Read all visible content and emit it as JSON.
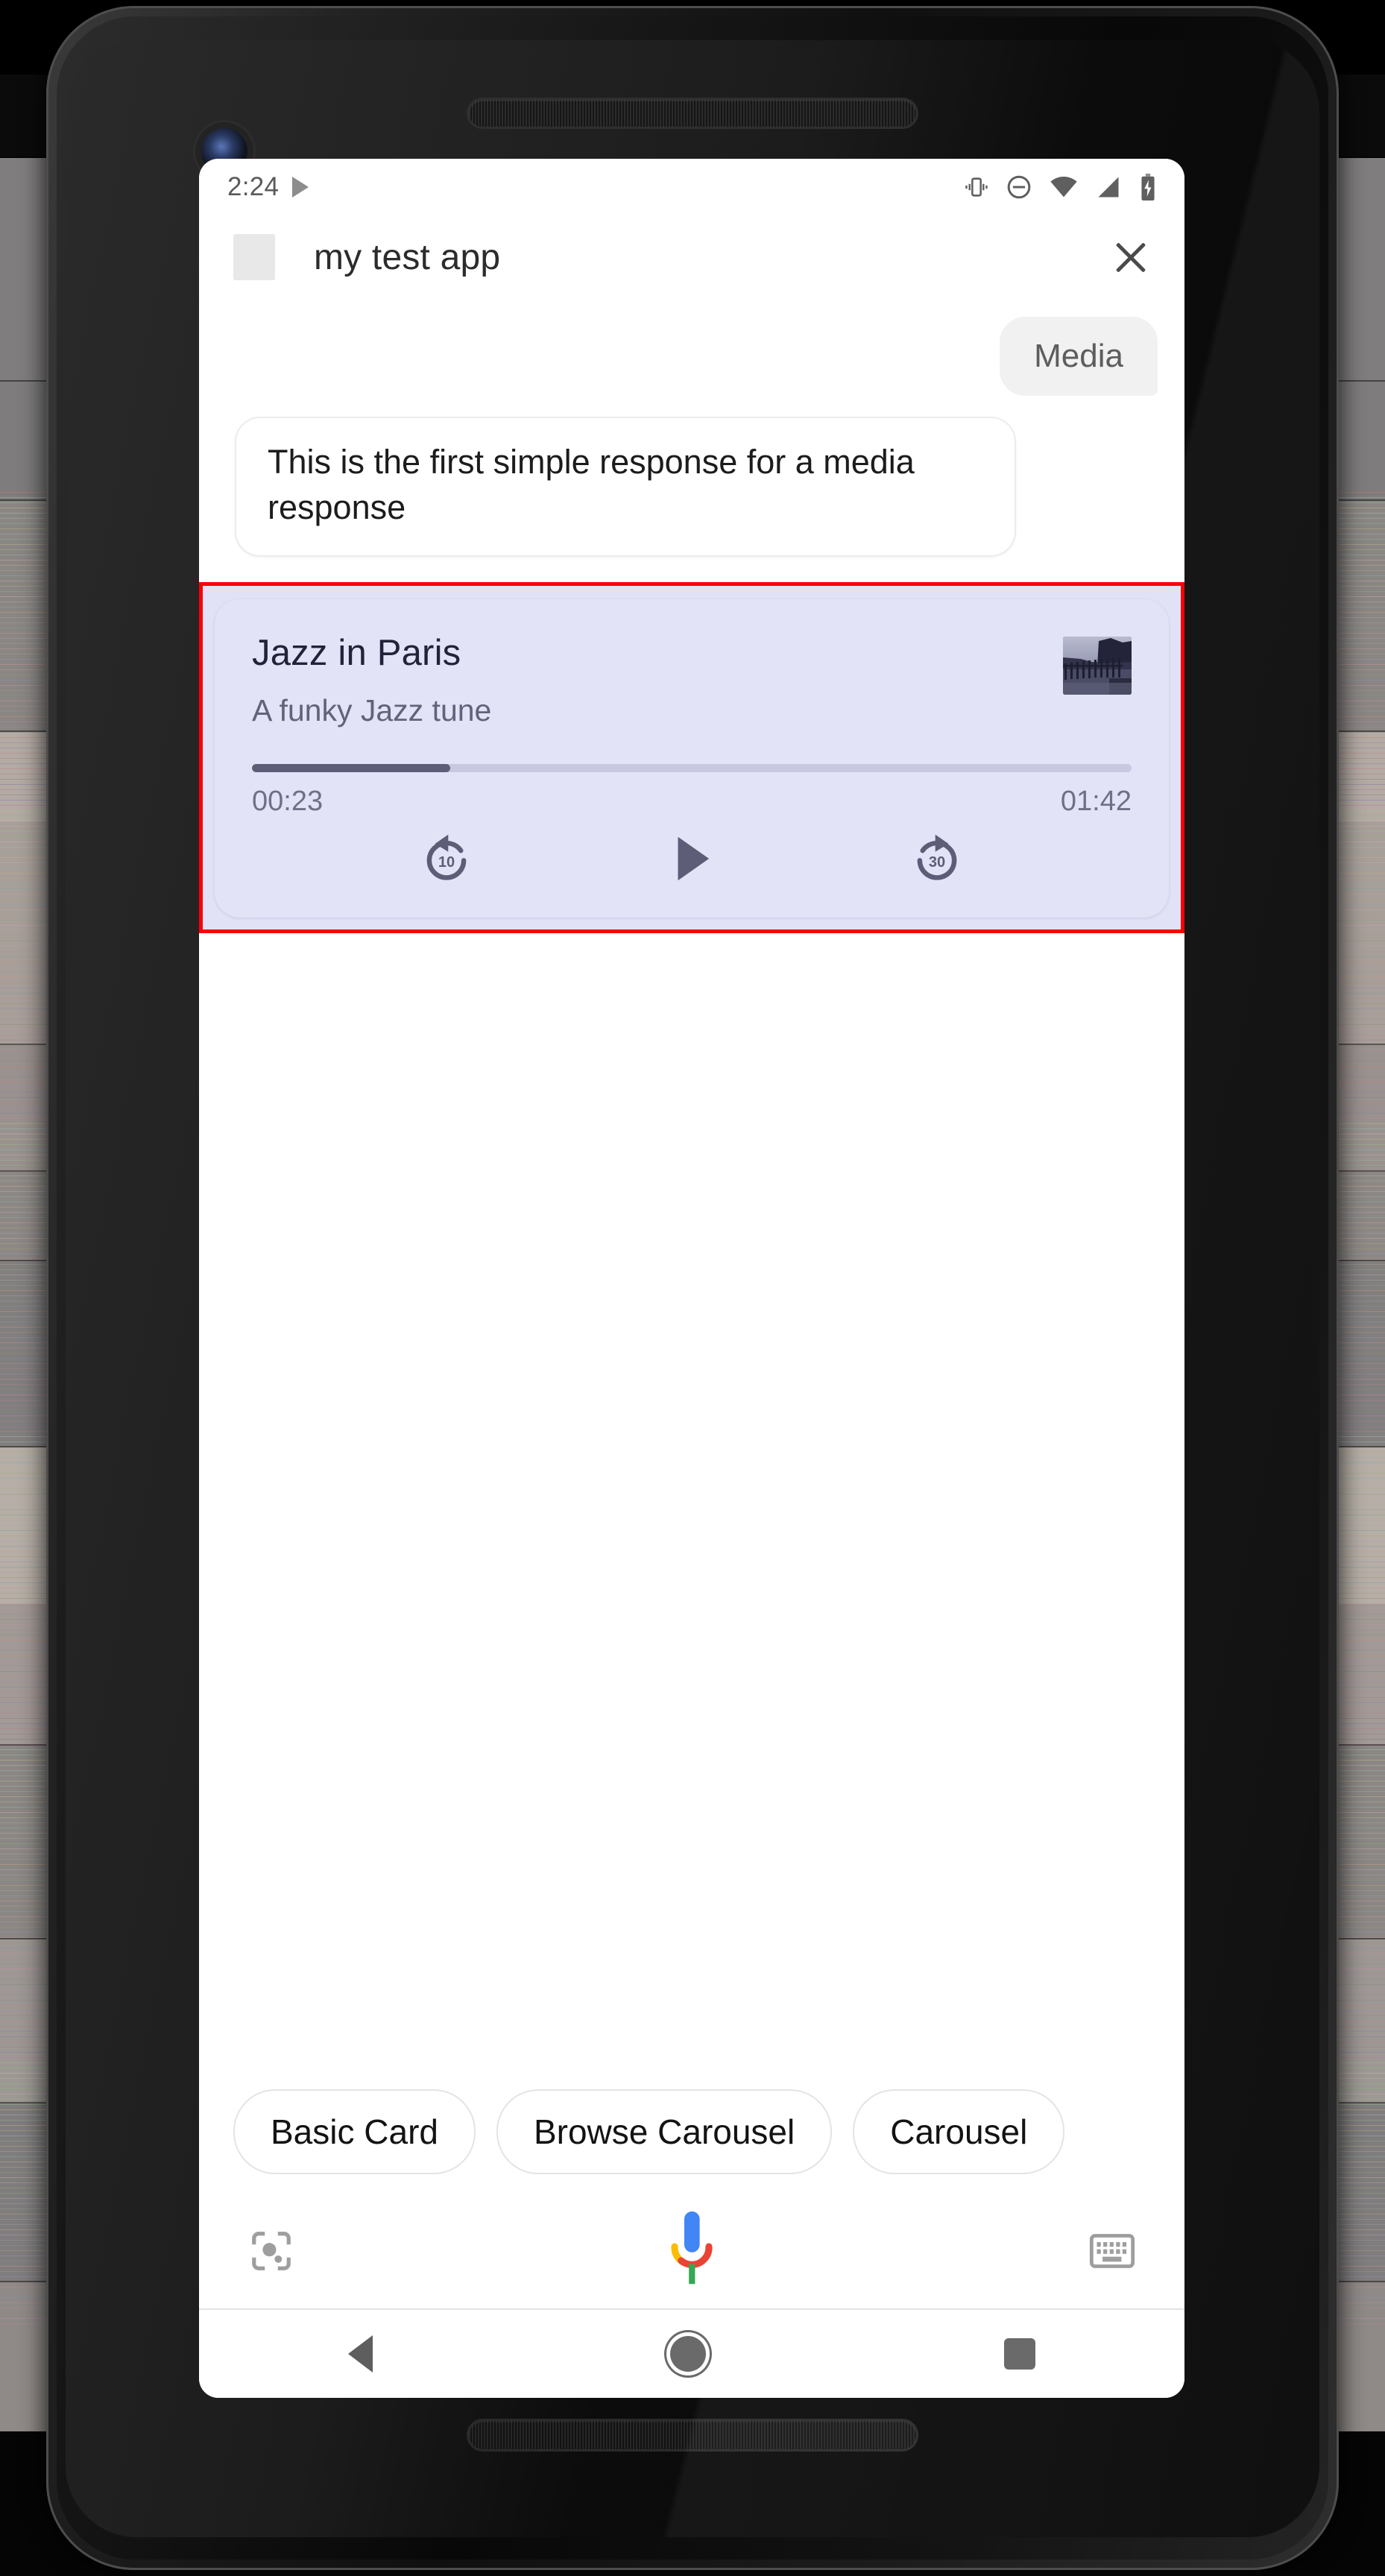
{
  "status_bar": {
    "time": "2:24",
    "icons": [
      "play-triangle-icon",
      "vibrate-icon",
      "do-not-disturb-icon",
      "wifi-icon",
      "cellular-signal-icon",
      "battery-charging-icon"
    ]
  },
  "app_header": {
    "title": "my test app",
    "close_label": "close-icon",
    "app_icon_name": "app-placeholder-icon"
  },
  "conversation": {
    "user_message": "Media",
    "bot_message": "This is the first simple response for a media response"
  },
  "media_card": {
    "title": "Jazz in Paris",
    "subtitle": "A funky Jazz tune",
    "current_time": "00:23",
    "total_time": "01:42",
    "progress_percent": 22.5,
    "highlight_color": "#fb0006",
    "card_background": "#e3e3f8",
    "accent_color": "#5d5d77",
    "track_color": "#c8c8e0",
    "controls": [
      {
        "name": "replay-10-icon",
        "label": "10"
      },
      {
        "name": "play-icon",
        "label": "Play"
      },
      {
        "name": "forward-30-icon",
        "label": "30"
      }
    ],
    "thumbnail_name": "album-art-thumbnail"
  },
  "suggestion_chips": [
    {
      "label": "Basic Card"
    },
    {
      "label": "Browse Carousel"
    },
    {
      "label": "Carousel"
    }
  ],
  "input_bar": {
    "lens_icon": "google-lens-icon",
    "mic_icon": "assistant-mic-icon",
    "keyboard_icon": "keyboard-icon",
    "google_colors": [
      "#4285f4",
      "#ea4335",
      "#fbbc05",
      "#34a853"
    ]
  },
  "nav_bar": {
    "back": "back-triangle-icon",
    "home": "home-circle-icon",
    "recents": "recents-square-icon"
  }
}
